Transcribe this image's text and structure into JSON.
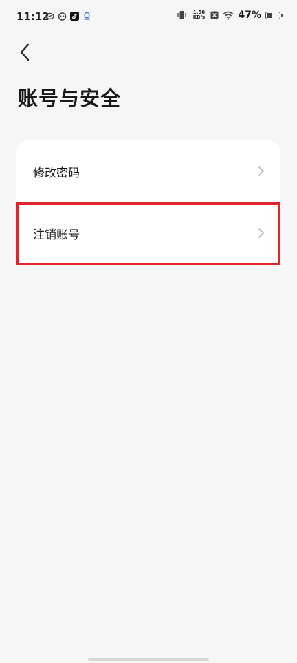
{
  "status_bar": {
    "time": "11:12",
    "left_icons": [
      "app-icon-1",
      "app-icon-2",
      "tiktok-icon",
      "notification-icon"
    ],
    "net_speed_value": "1.50",
    "net_speed_unit": "KB/s",
    "battery_percent_text": "47%",
    "battery_level": 0.47
  },
  "nav": {
    "back_icon": "chevron-left-icon"
  },
  "page": {
    "title": "账号与安全"
  },
  "settings": {
    "items": [
      {
        "label": "修改密码",
        "icon": "chevron-right-icon"
      },
      {
        "label": "注销账号",
        "icon": "chevron-right-icon",
        "highlighted": true
      }
    ]
  },
  "colors": {
    "background": "#f6f6f7",
    "card": "#ffffff",
    "highlight": "#e3232b",
    "text": "#1a1a1a",
    "chevron": "#b0b0b0"
  }
}
